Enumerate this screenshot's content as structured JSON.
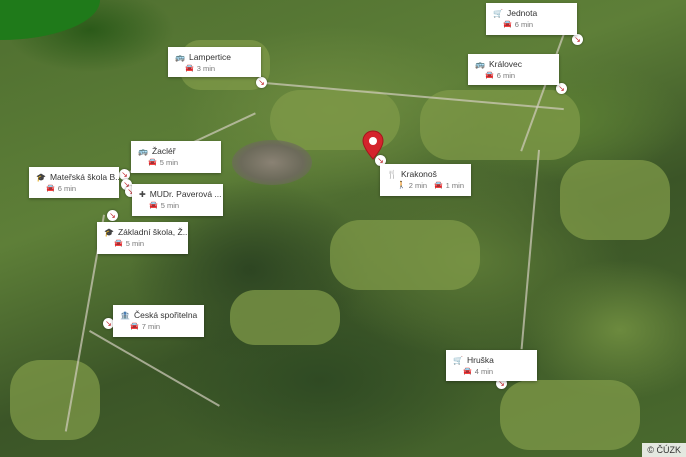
{
  "attribution": "© ČÚZK",
  "places": [
    {
      "id": "jednota",
      "title": "Jednota",
      "icon": "shopping-cart-icon",
      "glyph": "🛒",
      "time_mode": "car-icon",
      "time": "6 min"
    },
    {
      "id": "lampertice",
      "title": "Lampertice",
      "icon": "bus-icon",
      "glyph": "🚌",
      "time_mode": "car-icon",
      "time": "3 min"
    },
    {
      "id": "kralovec",
      "title": "Královec",
      "icon": "bus-icon",
      "glyph": "🚌",
      "time_mode": "car-icon",
      "time": "6 min"
    },
    {
      "id": "zacler",
      "title": "Žacléř",
      "icon": "bus-icon",
      "glyph": "🚌",
      "time_mode": "car-icon",
      "time": "5 min"
    },
    {
      "id": "krakonos",
      "title": "Krakonoš",
      "icon": "restaurant-icon",
      "glyph": "🍴",
      "walk_time": "2 min",
      "car_time": "1 min"
    },
    {
      "id": "materska",
      "title": "Mateřská škola B...",
      "icon": "school-icon",
      "glyph": "🎓",
      "time_mode": "car-icon",
      "time": "6 min"
    },
    {
      "id": "mudr",
      "title": "MUDr. Paverová ...",
      "icon": "medical-icon",
      "glyph": "✚",
      "time_mode": "car-icon",
      "time": "5 min"
    },
    {
      "id": "zakladni",
      "title": "Základní škola, Ž...",
      "icon": "school-icon",
      "glyph": "🎓",
      "time_mode": "car-icon",
      "time": "5 min"
    },
    {
      "id": "sporitelna",
      "title": "Česká spořitelna",
      "icon": "bank-icon",
      "glyph": "🏦",
      "time_mode": "car-icon",
      "time": "7 min"
    },
    {
      "id": "hruska",
      "title": "Hruška",
      "icon": "shopping-cart-icon",
      "glyph": "🛒",
      "time_mode": "car-icon",
      "time": "4 min"
    }
  ],
  "marker_glyph": "↘",
  "walk_glyph": "🚶",
  "car_glyph": "🚘"
}
